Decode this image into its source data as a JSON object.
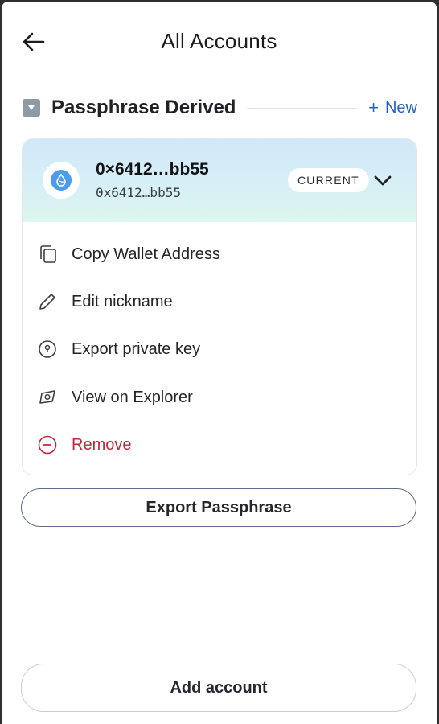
{
  "header": {
    "title": "All Accounts",
    "back_icon": "arrow-left-icon"
  },
  "group": {
    "name": "Passphrase Derived",
    "new_label": "New",
    "new_plus": "+",
    "toggle_icon": "caret-down-icon"
  },
  "account": {
    "name": "0×6412…bb55",
    "address": "0x6412…bb55",
    "badge": "CURRENT",
    "avatar_icon": "sui-drop-icon",
    "expand_icon": "chevron-down-icon"
  },
  "menu": {
    "items": [
      {
        "label": "Copy Wallet Address",
        "icon": "copy-icon"
      },
      {
        "label": "Edit nickname",
        "icon": "pencil-icon"
      },
      {
        "label": "Export private key",
        "icon": "key-icon"
      },
      {
        "label": "View on Explorer",
        "icon": "explorer-icon"
      },
      {
        "label": "Remove",
        "icon": "remove-icon"
      }
    ]
  },
  "buttons": {
    "export_passphrase": "Export Passphrase",
    "add_account": "Add account"
  },
  "colors": {
    "accent": "#2564c2",
    "danger": "#c3283a",
    "toggle": "#8e9aa6",
    "avatar": "#4b9bf0"
  }
}
